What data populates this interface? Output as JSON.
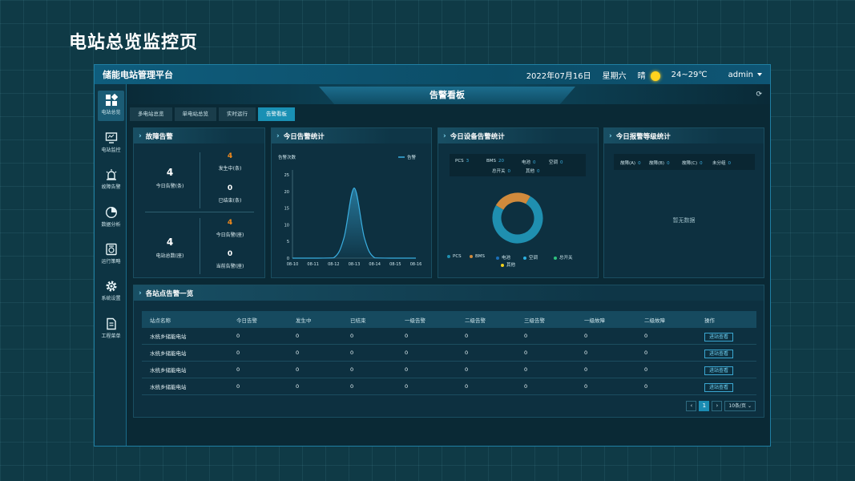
{
  "page_heading": "电站总览监控页",
  "topbar": {
    "app_title": "储能电站管理平台",
    "date": "2022年07月16日",
    "weekday": "星期六",
    "weather": "晴",
    "temperature": "24~29℃",
    "user": "admin"
  },
  "sidebar": {
    "items": [
      {
        "label": "电站总览",
        "icon": "grid-icon"
      },
      {
        "label": "电站监控",
        "icon": "monitor-icon"
      },
      {
        "label": "故障告警",
        "icon": "alarm-icon"
      },
      {
        "label": "数据分析",
        "icon": "pie-chart-icon"
      },
      {
        "label": "运行策略",
        "icon": "strategy-icon"
      },
      {
        "label": "系统设置",
        "icon": "gear-icon"
      },
      {
        "label": "工程菜单",
        "icon": "document-icon"
      }
    ]
  },
  "banner_title": "告警看板",
  "refresh_icon": "refresh-icon",
  "tabs": [
    "多电站总览",
    "单电站总览",
    "实时运行",
    "告警看板"
  ],
  "fault_panel": {
    "title": "故障告警",
    "today_alarms": {
      "value": "4",
      "label": "今日告警(条)"
    },
    "occurring": {
      "value": "4",
      "label": "发生中(条)"
    },
    "ended": {
      "value": "0",
      "label": "已结束(条)"
    },
    "station_total": {
      "value": "4",
      "label": "电站总数(座)"
    },
    "today_alarm_stations": {
      "value": "4",
      "label": "今日告警(座)"
    },
    "current_alarm_stations": {
      "value": "0",
      "label": "当前告警(座)"
    }
  },
  "today_stats": {
    "title": "今日告警统计",
    "y_unit": "告警次数",
    "legend": "告警"
  },
  "chart_data": {
    "type": "area",
    "legend": [
      "告警"
    ],
    "ylabel": "告警次数",
    "ylim": [
      0,
      25
    ],
    "yticks": [
      "0",
      "5",
      "10",
      "15",
      "20",
      "25"
    ],
    "x": [
      "08-10",
      "08-11",
      "08-12",
      "08-13",
      "08-14",
      "08-15",
      "08-16"
    ],
    "series": [
      {
        "name": "告警",
        "x": [
          0,
          1,
          2,
          2.5,
          3,
          3.5,
          4,
          5,
          6
        ],
        "values": [
          0,
          0,
          0.1,
          6,
          21,
          6,
          0.1,
          0,
          0
        ]
      }
    ],
    "color": "#3aaee0",
    "grid": false
  },
  "device_stats": {
    "title": "今日设备告警统计",
    "counts": [
      {
        "name": "PCS",
        "value": "3"
      },
      {
        "name": "BMS",
        "value": "20"
      },
      {
        "name": "电池",
        "value": "0"
      },
      {
        "name": "空调",
        "value": "0"
      },
      {
        "name": "总开关",
        "value": "0"
      },
      {
        "name": "其他",
        "value": "0"
      }
    ],
    "legend": [
      {
        "name": "PCS",
        "color": "#1f8fb0"
      },
      {
        "name": "BMS",
        "color": "#d08a3c"
      },
      {
        "name": "电池",
        "color": "#1b6fb8"
      },
      {
        "name": "空调",
        "color": "#2bb0e0"
      },
      {
        "name": "总开关",
        "color": "#2ec27e"
      },
      {
        "name": "其他",
        "color": "#f3d21c"
      }
    ],
    "donut": [
      {
        "name": "PCS",
        "value": 3,
        "color": "#1f8fb0"
      },
      {
        "name": "BMS",
        "value": 1,
        "color": "#d08a3c"
      }
    ]
  },
  "level_stats": {
    "title": "今日报警等级统计",
    "counts": [
      {
        "name": "故障(A)",
        "value": "0"
      },
      {
        "name": "故障(B)",
        "value": "0"
      },
      {
        "name": "故障(C)",
        "value": "0"
      },
      {
        "name": "未分组",
        "value": "0"
      }
    ],
    "empty_text": "暂无数据"
  },
  "station_list": {
    "title": "各站点告警一览",
    "columns": [
      "站点名称",
      "今日告警",
      "发生中",
      "已结束",
      "一级告警",
      "二级告警",
      "三级告警",
      "一级故障",
      "二级故障",
      "操作"
    ],
    "rows": [
      [
        "水统乡储能电站",
        "0",
        "0",
        "0",
        "0",
        "0",
        "0",
        "0",
        "0",
        "进站查看"
      ],
      [
        "水统乡储能电站",
        "0",
        "0",
        "0",
        "0",
        "0",
        "0",
        "0",
        "0",
        "进站查看"
      ],
      [
        "水统乡储能电站",
        "0",
        "0",
        "0",
        "0",
        "0",
        "0",
        "0",
        "0",
        "进站查看"
      ],
      [
        "水统乡储能电站",
        "0",
        "0",
        "0",
        "0",
        "0",
        "0",
        "0",
        "0",
        "进站查看"
      ]
    ],
    "pagination": {
      "prev": "‹",
      "page": "1",
      "next": "›",
      "page_size": "10条/页"
    }
  },
  "colors": {
    "accent": "#1990b4",
    "orange": "#f28a1d",
    "line": "#3aaee0"
  }
}
